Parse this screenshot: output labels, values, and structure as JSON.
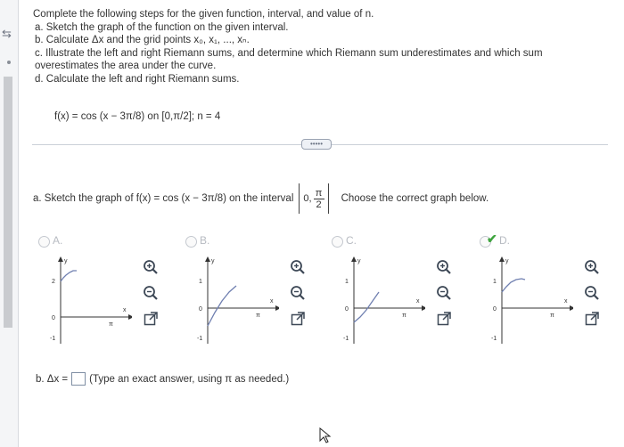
{
  "problem": {
    "intro": "Complete the following steps for the given function, interval, and value of n.",
    "steps": [
      "a. Sketch the graph of the function on the given interval.",
      "b. Calculate Δx and the grid points x₀, x₁, ..., xₙ.",
      "c. Illustrate the left and right Riemann sums, and determine which Riemann sum underestimates and which sum",
      "overestimates the area under the curve.",
      "d. Calculate the left and right Riemann sums."
    ],
    "function": "f(x) = cos (x − 3π/8) on [0,π/2]; n = 4"
  },
  "more_button": "•••••",
  "part_a": {
    "prefix": "a. Sketch the graph of f(x) = cos (x − 3π/8) on the interval",
    "interval_left": "0,",
    "frac_num": "π",
    "frac_den": "2",
    "instruction": "Choose the correct graph below."
  },
  "options": [
    {
      "label": "A.",
      "selected": false,
      "graph": {
        "ytick_top": "2",
        "ytick_mid": "0",
        "ytick_bottom": "-1",
        "y_label": "y",
        "x_label": "x",
        "x_tick": "π"
      }
    },
    {
      "label": "B.",
      "selected": false,
      "graph": {
        "ytick_top": "1",
        "ytick_mid": "0",
        "ytick_bottom": "-1",
        "y_label": "y",
        "x_label": "x",
        "x_tick": "π"
      }
    },
    {
      "label": "C.",
      "selected": false,
      "graph": {
        "ytick_top": "1",
        "ytick_mid": "0",
        "ytick_bottom": "-1",
        "y_label": "y",
        "x_label": "x",
        "x_tick": "π"
      }
    },
    {
      "label": "D.",
      "selected": true,
      "graph": {
        "ytick_top": "1",
        "ytick_mid": "0",
        "ytick_bottom": "-1",
        "y_label": "y",
        "x_label": "x",
        "x_tick": "π"
      }
    }
  ],
  "part_b": {
    "prefix": "b. Δx =",
    "hint": "(Type an exact answer, using π as needed.)"
  },
  "icons": {
    "zoom_in": "zoom-in-icon",
    "zoom_out": "zoom-out-icon",
    "expand": "expand-icon"
  },
  "colors": {
    "check": "#3ea43e",
    "tool": "#3d4856",
    "curve": "#6f7fb0"
  }
}
